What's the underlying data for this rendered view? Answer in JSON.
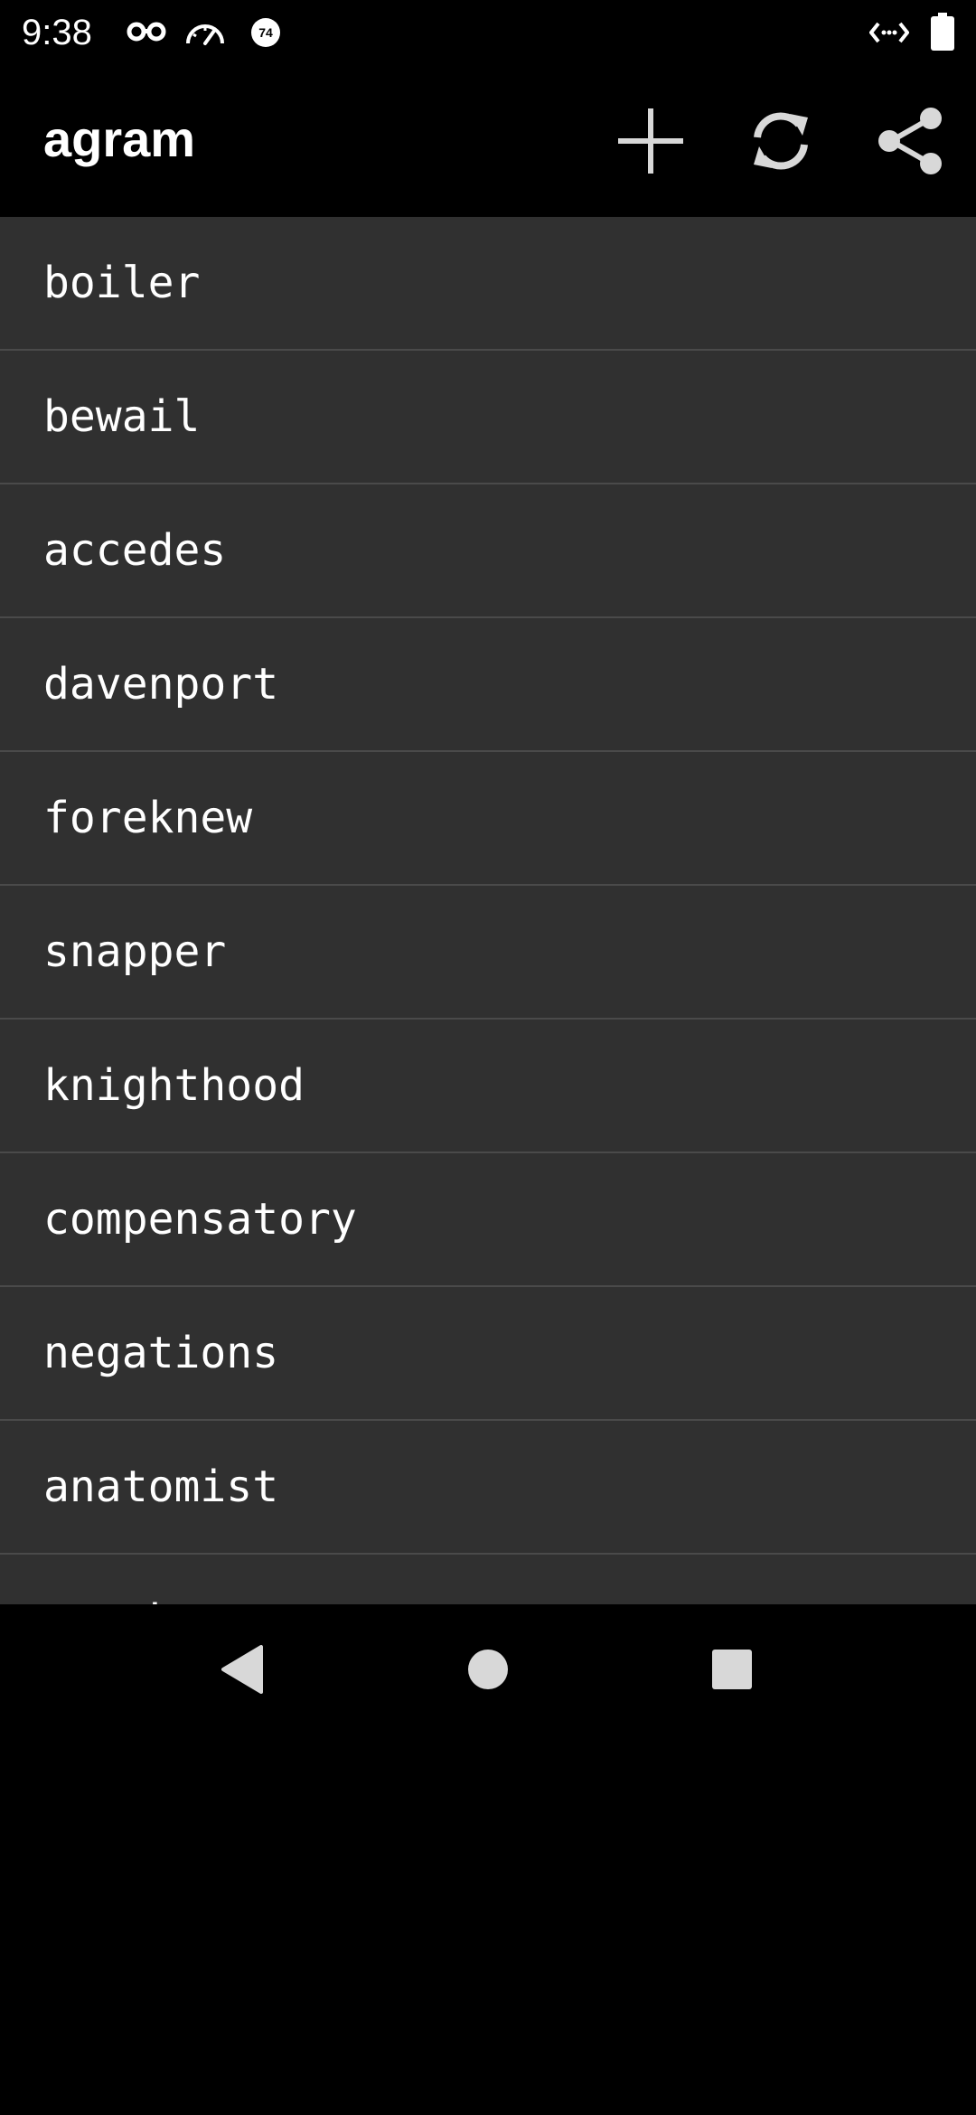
{
  "status_bar": {
    "time": "9:38",
    "notification_icons": [
      "incognito-mask-icon",
      "speedometer-icon",
      "badge-74-icon"
    ],
    "badge_number": "74",
    "right_icons": [
      "code-brackets-icon",
      "battery-icon"
    ]
  },
  "app_bar": {
    "title": "agram",
    "actions": [
      "add-icon",
      "refresh-icon",
      "share-icon"
    ]
  },
  "list": {
    "items": [
      "boiler",
      "bewail",
      "accedes",
      "davenport",
      "foreknew",
      "snapper",
      "knighthood",
      "compensatory",
      "negations",
      "anatomist",
      "tweaks"
    ]
  },
  "nav_bar": {
    "buttons": [
      "back-icon",
      "home-icon",
      "recents-icon"
    ]
  },
  "colors": {
    "background": "#000000",
    "list_background": "#303030",
    "divider": "#4a4a4a",
    "icon": "#d8d8d8",
    "text": "#ffffff"
  }
}
